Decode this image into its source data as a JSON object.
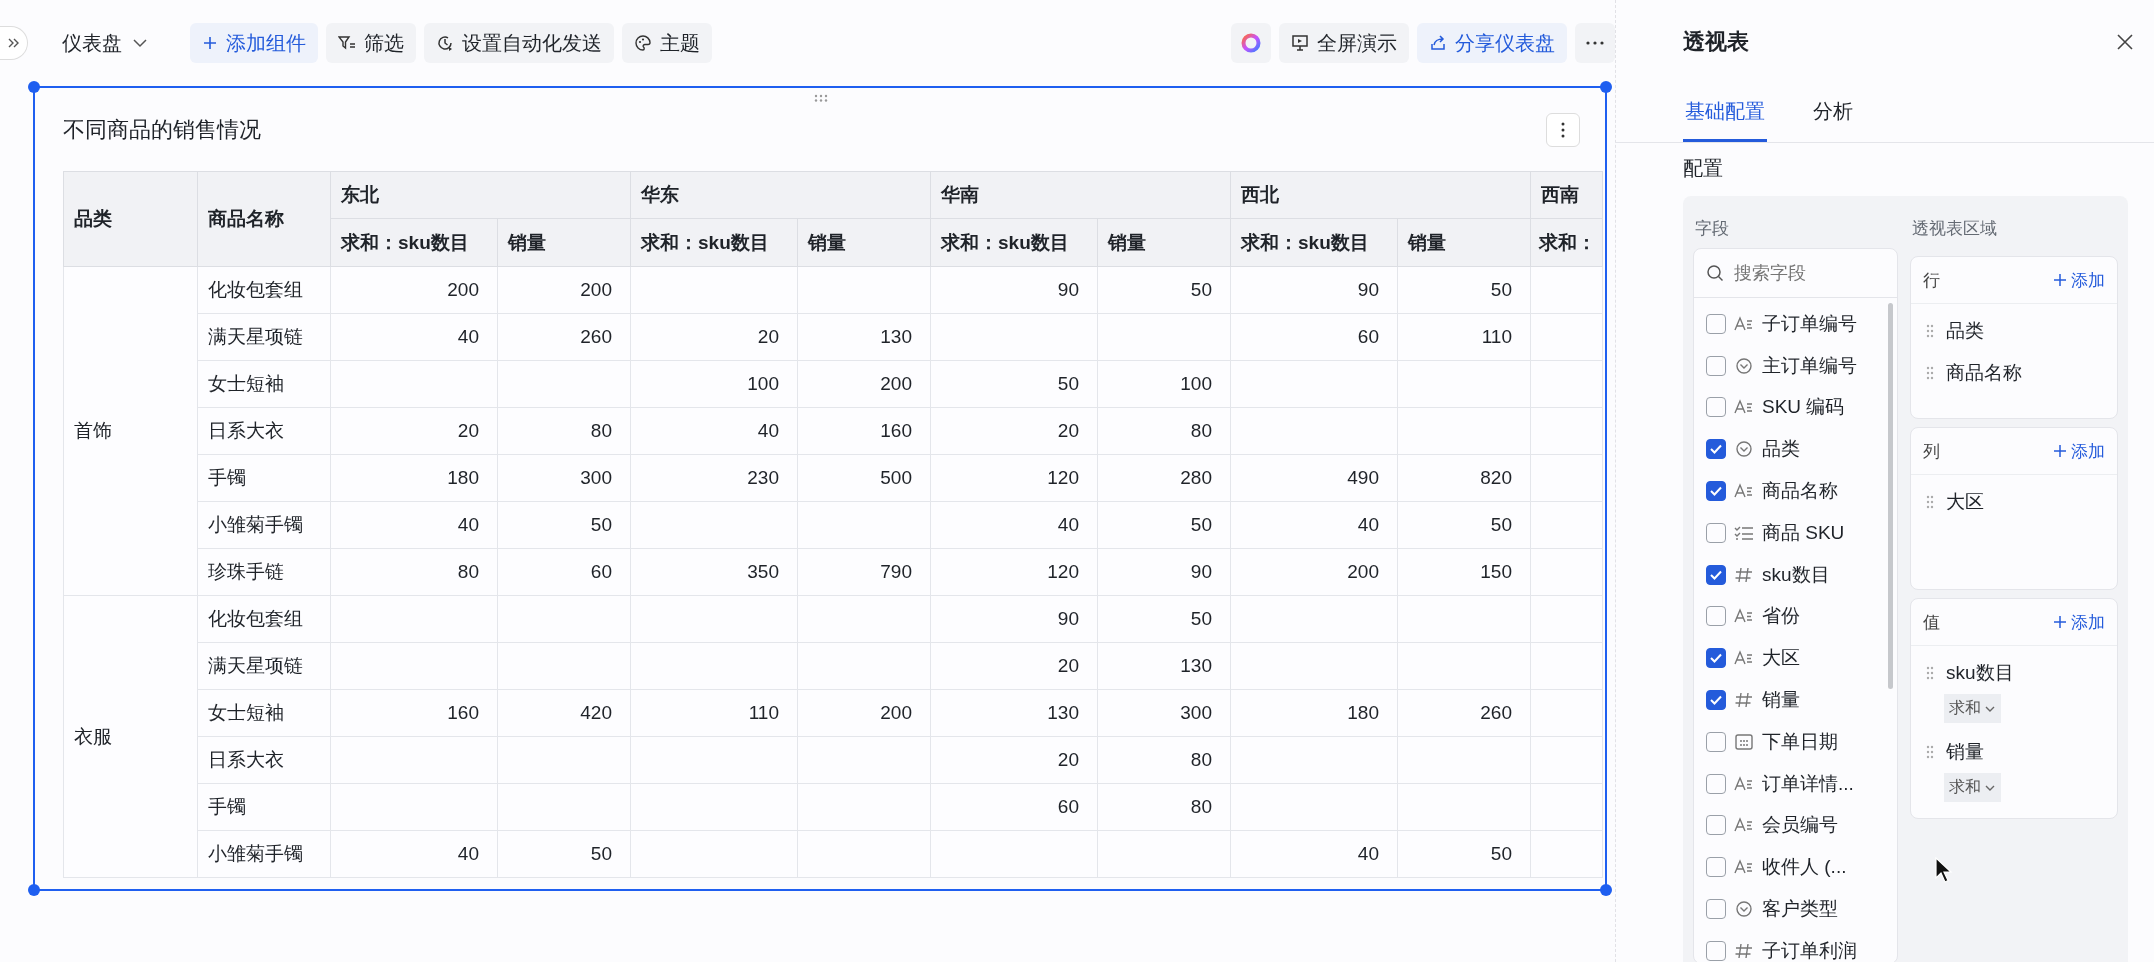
{
  "toolbar": {
    "title": "仪表盘",
    "buttons": [
      {
        "label": "添加组件",
        "kind": "add"
      },
      {
        "label": "筛选",
        "kind": "filter"
      },
      {
        "label": "设置自动化发送",
        "kind": "schedule"
      },
      {
        "label": "主题",
        "kind": "theme"
      }
    ],
    "right_buttons": [
      {
        "label": "全屏演示",
        "kind": "present"
      },
      {
        "label": "分享仪表盘",
        "kind": "share"
      }
    ]
  },
  "widget": {
    "title": "不同商品的销售情况",
    "selected": true,
    "table": {
      "row_headers": [
        "品类",
        "商品名称"
      ],
      "regions": [
        {
          "name": "东北",
          "measures": [
            "求和：sku数目",
            "销量"
          ]
        },
        {
          "name": "华东",
          "measures": [
            "求和：sku数目",
            "销量"
          ]
        },
        {
          "name": "华南",
          "measures": [
            "求和：sku数目",
            "销量"
          ]
        },
        {
          "name": "西北",
          "measures": [
            "求和：sku数目",
            "销量"
          ]
        },
        {
          "name": "西南",
          "measures": [
            "求和："
          ]
        }
      ],
      "groups": [
        {
          "category": "首饰",
          "rows": [
            {
              "name": "化妆包套组",
              "values": {
                "col_1": "200",
                "col_2": "200",
                "col_5": "90",
                "col_6": "50",
                "col_7": "90",
                "col_8": "50"
              }
            },
            {
              "name": "满天星项链",
              "values": {
                "col_1": "40",
                "col_2": "260",
                "col_3": "20",
                "col_4": "130",
                "col_7": "60",
                "col_8": "110"
              }
            },
            {
              "name": "女士短袖",
              "values": {
                "col_3": "100",
                "col_4": "200",
                "col_5": "50",
                "col_6": "100"
              }
            },
            {
              "name": "日系大衣",
              "values": {
                "col_1": "20",
                "col_2": "80",
                "col_3": "40",
                "col_4": "160",
                "col_5": "20",
                "col_6": "80"
              }
            },
            {
              "name": "手镯",
              "values": {
                "col_1": "180",
                "col_2": "300",
                "col_3": "230",
                "col_4": "500",
                "col_5": "120",
                "col_6": "280",
                "col_7": "490",
                "col_8": "820"
              }
            },
            {
              "name": "小雏菊手镯",
              "values": {
                "col_1": "40",
                "col_2": "50",
                "col_5": "40",
                "col_6": "50",
                "col_7": "40",
                "col_8": "50"
              }
            },
            {
              "name": "珍珠手链",
              "values": {
                "col_1": "80",
                "col_2": "60",
                "col_3": "350",
                "col_4": "790",
                "col_5": "120",
                "col_6": "90",
                "col_7": "200",
                "col_8": "150"
              }
            }
          ]
        },
        {
          "category": "衣服",
          "rows": [
            {
              "name": "化妆包套组",
              "values": {
                "col_5": "90",
                "col_6": "50"
              }
            },
            {
              "name": "满天星项链",
              "values": {
                "col_5": "20",
                "col_6": "130"
              }
            },
            {
              "name": "女士短袖",
              "values": {
                "col_1": "160",
                "col_2": "420",
                "col_3": "110",
                "col_4": "200",
                "col_5": "130",
                "col_6": "300",
                "col_7": "180",
                "col_8": "260"
              }
            },
            {
              "name": "日系大衣",
              "values": {
                "col_5": "20",
                "col_6": "80"
              }
            },
            {
              "name": "手镯",
              "values": {
                "col_5": "60",
                "col_6": "80"
              }
            },
            {
              "name": "小雏菊手镯",
              "values": {
                "col_1": "40",
                "col_2": "50",
                "col_7": "40",
                "col_8": "50"
              }
            }
          ]
        }
      ]
    }
  },
  "panel": {
    "title": "透视表",
    "tabs": [
      {
        "label": "基础配置",
        "selected": true
      },
      {
        "label": "分析",
        "selected": false
      }
    ],
    "section": "配置",
    "fields_label": "字段",
    "areas_label": "透视表区域",
    "search": {
      "placeholder": "搜索字段"
    },
    "fields": [
      {
        "label": "子订单编号",
        "kind": "text",
        "checked": false
      },
      {
        "label": "主订单编号",
        "kind": "option",
        "checked": false
      },
      {
        "label": "SKU 编码",
        "kind": "text",
        "checked": false
      },
      {
        "label": "品类",
        "kind": "option",
        "checked": true
      },
      {
        "label": "商品名称",
        "kind": "text",
        "checked": true
      },
      {
        "label": "商品 SKU",
        "kind": "list",
        "checked": false
      },
      {
        "label": "sku数目",
        "kind": "number",
        "checked": true
      },
      {
        "label": "省份",
        "kind": "text",
        "checked": false
      },
      {
        "label": "大区",
        "kind": "text",
        "checked": true
      },
      {
        "label": "销量",
        "kind": "number",
        "checked": true
      },
      {
        "label": "下单日期",
        "kind": "date",
        "checked": false
      },
      {
        "label": "订单详情...",
        "kind": "text",
        "checked": false
      },
      {
        "label": "会员编号",
        "kind": "text",
        "checked": false
      },
      {
        "label": "收件人 (...",
        "kind": "text",
        "checked": false
      },
      {
        "label": "客户类型",
        "kind": "option",
        "checked": false
      },
      {
        "label": "子订单利润",
        "kind": "number",
        "checked": false
      }
    ],
    "areas": [
      {
        "title": "行",
        "add": "添加",
        "items": [
          {
            "label": "品类"
          },
          {
            "label": "商品名称"
          }
        ]
      },
      {
        "title": "列",
        "add": "添加",
        "items": [
          {
            "label": "大区"
          }
        ]
      },
      {
        "title": "值",
        "add": "添加",
        "items": [
          {
            "label": "sku数目",
            "aggregate": "求和"
          },
          {
            "label": "销量",
            "aggregate": "求和"
          }
        ]
      }
    ]
  }
}
